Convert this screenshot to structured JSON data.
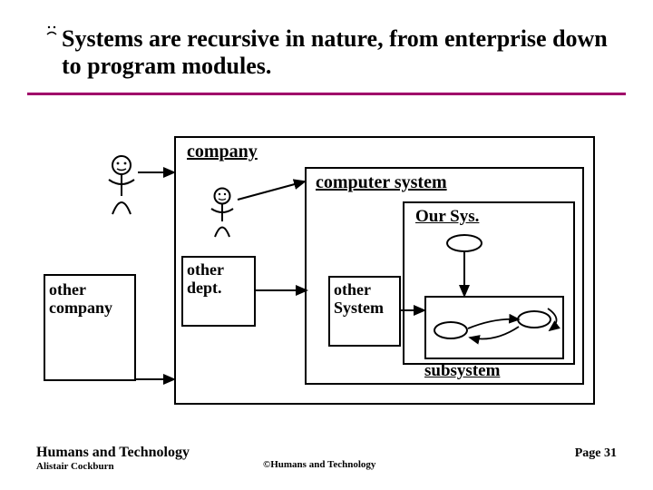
{
  "title": "Systems are recursive in nature, from enterprise down to program modules.",
  "boxes": {
    "company": "company",
    "computer_system": "computer system",
    "our_sys": "Our Sys.",
    "other_dept": "other dept.",
    "other_company": "other company",
    "other_system": "other System",
    "subsystem": "subsystem"
  },
  "footer": {
    "org": "Humans and Technology",
    "author": "Alistair Cockburn",
    "copyright": "©Humans and Technology",
    "page": "Page 31"
  }
}
